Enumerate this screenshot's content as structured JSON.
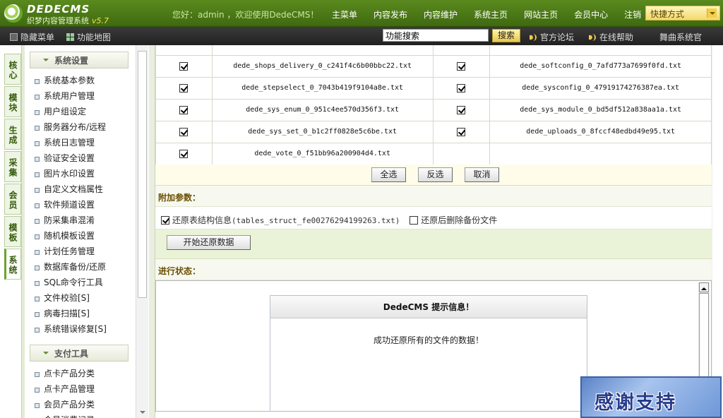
{
  "header": {
    "logo_title": "DEDECMS",
    "logo_subtitle": "织梦内容管理系统",
    "logo_version": "v5.7",
    "greeting": "您好：admin ，欢迎使用DedeCMS！",
    "nav": [
      "主菜单",
      "内容发布",
      "内容维护",
      "系统主页",
      "网站主页",
      "会员中心",
      "注销"
    ],
    "quick_menu": "快捷方式"
  },
  "subbar": {
    "hide_menu": "隐藏菜单",
    "site_map": "功能地图",
    "search_value": "功能搜索",
    "search_button": "搜索",
    "forum": "官方论坛",
    "help": "在线帮助",
    "vendor": "舞曲系统官"
  },
  "vtabs": [
    "核心",
    "模块",
    "生成",
    "采集",
    "会员",
    "模板",
    "系统"
  ],
  "leftmenu": {
    "group1": "系统设置",
    "group1_items": [
      "系统基本参数",
      "系统用户管理",
      "用户组设定",
      "服务器分布/远程",
      "系统日志管理",
      "验证安全设置",
      "图片水印设置",
      "自定义文档属性",
      "软件频道设置",
      "防采集串混淆",
      "随机模板设置",
      "计划任务管理",
      "数据库备份/还原",
      "SQL命令行工具",
      "文件校验[S]",
      "病毒扫描[S]",
      "系统错误修复[S]"
    ],
    "group2": "支付工具",
    "group2_items": [
      "点卡产品分类",
      "点卡产品管理",
      "会员产品分类",
      "会员消费记录"
    ]
  },
  "files": [
    [
      "dede_shops_delivery_0_c241f4c6b00bbc22.txt",
      "dede_softconfig_0_7afd773a7699f0fd.txt"
    ],
    [
      "dede_stepselect_0_7043b419f9104a8e.txt",
      "dede_sysconfig_0_47919174276387ea.txt"
    ],
    [
      "dede_sys_enum_0_951c4ee570d356f3.txt",
      "dede_sys_module_0_bd5df512a838aa1a.txt"
    ],
    [
      "dede_sys_set_0_b1c2ff0828e5c6be.txt",
      "dede_uploads_0_8fccf48edbd49e95.txt"
    ],
    [
      "dede_vote_0_f51bb96a200904d4.txt",
      ""
    ]
  ],
  "buttons": {
    "select_all": "全选",
    "invert": "反选",
    "cancel": "取消",
    "start_restore": "开始还原数据"
  },
  "extra": {
    "title": "附加参数：",
    "restore_struct": "还原表结构信息",
    "struct_file": "(tables_struct_fe00276294199263.txt)",
    "delete_after": "还原后删除备份文件"
  },
  "status": {
    "title": "进行状态：",
    "box_title": "DedeCMS 提示信息！",
    "box_message": "成功还原所有的文件的数据！"
  },
  "banner": "感谢支持",
  "colors": {
    "header_green": "#4f7d18",
    "accent_gold": "#f3d86a",
    "section_text": "#6b4e00"
  }
}
